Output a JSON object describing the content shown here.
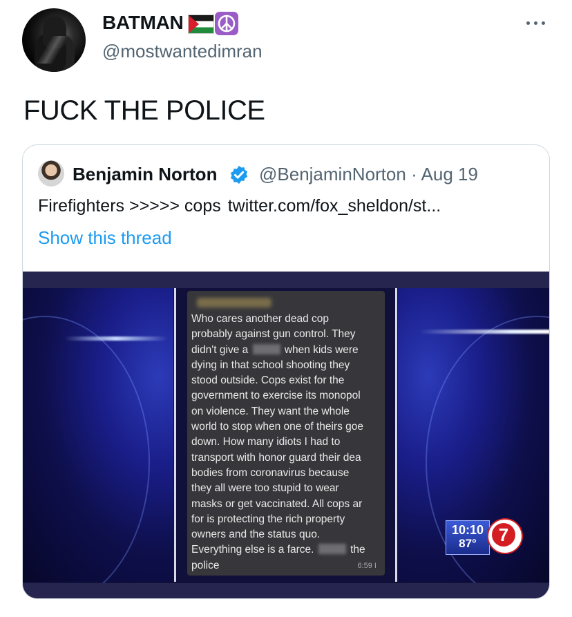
{
  "tweet": {
    "display_name": "BATMAN",
    "name_emojis": [
      "palestine-flag-emoji",
      "peace-symbol-emoji"
    ],
    "handle": "@mostwantedimran",
    "text": "FUCK THE POLICE",
    "more_icon": "more-horizontal-icon"
  },
  "quoted": {
    "display_name": "Benjamin Norton",
    "verified_icon": "verified-badge-icon",
    "handle": "@BenjaminNorton",
    "separator": "·",
    "date": "Aug 19",
    "text": "Firefighters >>>>> cops",
    "link": "twitter.com/fox_sheldon/st...",
    "show_thread": "Show this thread"
  },
  "media": {
    "message_lines": [
      "Who cares another dead cop",
      "probably against gun control. They",
      "didn't give a [redacted] when kids were",
      "dying in that school shooting they",
      "stood outside. Cops exist for the",
      "government to exercise its monopol",
      "on violence. They want the whole",
      "world to stop when one of theirs goe",
      "down. How many idiots I had to",
      "transport with honor guard their dea",
      "bodies from coronavirus because",
      "they all were too stupid to wear",
      "masks or get vaccinated. All cops ar",
      "for is protecting the rich property",
      "owners and the status quo.",
      "Everything else is a farce. [redacted] the",
      "police"
    ],
    "message_time": "6:59 I",
    "clock_time": "10:10",
    "temperature": "87°",
    "channel_number": "7",
    "colors": {
      "accent_red": "#d41d22",
      "background_navy": "#11103a"
    }
  }
}
